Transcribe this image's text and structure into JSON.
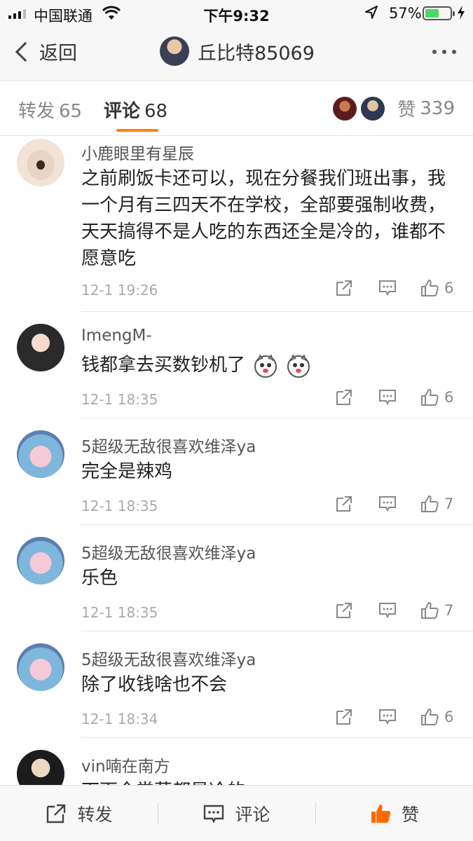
{
  "status_bar": {
    "carrier": "中国联通",
    "time": "下午9:32",
    "battery_pct": "57%",
    "battery_level": 0.57
  },
  "nav": {
    "back_label": "返回",
    "title": "丘比特85069"
  },
  "tabs": {
    "repost_label": "转发",
    "repost_count": "65",
    "comment_label": "评论",
    "comment_count": "68",
    "like_label": "赞",
    "like_count": "339"
  },
  "comments": [
    {
      "name": "小鹿眼里有星辰",
      "text": "之前刷饭卡还可以，现在分餐我们班出事，我一个月有三四天不在学校，全部要强制收费，天天搞得不是人吃的东西还全是冷的，谁都不愿意吃",
      "time": "12-1 19:26",
      "likes": "6"
    },
    {
      "name": "ImengM-",
      "text": "钱都拿去买数钞机了",
      "time": "12-1 18:35",
      "likes": "6"
    },
    {
      "name": "5超级无敌很喜欢维泽ya",
      "text": "完全是辣鸡",
      "time": "12-1 18:35",
      "likes": "7"
    },
    {
      "name": "5超级无敌很喜欢维泽ya",
      "text": "乐色",
      "time": "12-1 18:35",
      "likes": "7"
    },
    {
      "name": "5超级无敌很喜欢维泽ya",
      "text": "除了收钱啥也不会",
      "time": "12-1 18:34",
      "likes": "6"
    },
    {
      "name": "vin喃在南方",
      "text": "下面全常菜都是冷的"
    }
  ],
  "toolbar": {
    "repost_label": "转发",
    "comment_label": "评论",
    "like_label": "赞"
  },
  "colors": {
    "accent": "#ff8200",
    "battery": "#4cd964",
    "like_active": "#ff6a00"
  }
}
